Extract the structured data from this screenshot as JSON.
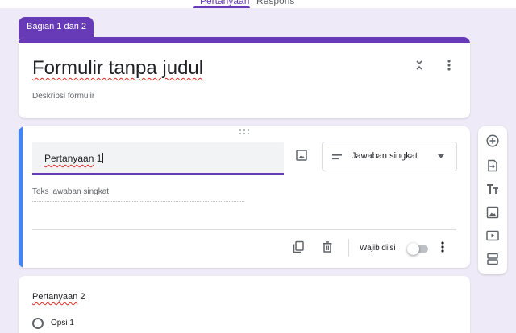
{
  "top_tabs": [
    {
      "label": "Pertanyaan",
      "active": true
    },
    {
      "label": "Respons",
      "active": false
    }
  ],
  "section_tab": {
    "label": "Bagian 1 dari 2"
  },
  "form": {
    "title": "Formulir tanpa judul",
    "description_placeholder": "Deskripsi formulir"
  },
  "question1": {
    "title": "Pertanyaan",
    "title_suffix": " 1",
    "type": {
      "label": "Jawaban singkat",
      "icon": "short-text-icon"
    },
    "answer_placeholder": "Teks jawaban singkat",
    "required_label": "Wajib diisi",
    "required": false
  },
  "question2": {
    "title": "Pertanyaan",
    "title_suffix": " 2",
    "options": [
      {
        "label": "Opsi 1"
      }
    ]
  },
  "sidebar_tools": [
    {
      "name": "add-question",
      "icon": "plus-circle-icon"
    },
    {
      "name": "import-questions",
      "icon": "import-icon"
    },
    {
      "name": "add-title",
      "icon": "title-text-icon"
    },
    {
      "name": "add-image",
      "icon": "image-icon"
    },
    {
      "name": "add-video",
      "icon": "video-icon"
    },
    {
      "name": "add-section",
      "icon": "section-icon"
    }
  ],
  "colors": {
    "accent": "#673ab7",
    "active_card_indicator": "#4285f4",
    "background": "#efeaf7",
    "spellcheck": "#d93025"
  }
}
